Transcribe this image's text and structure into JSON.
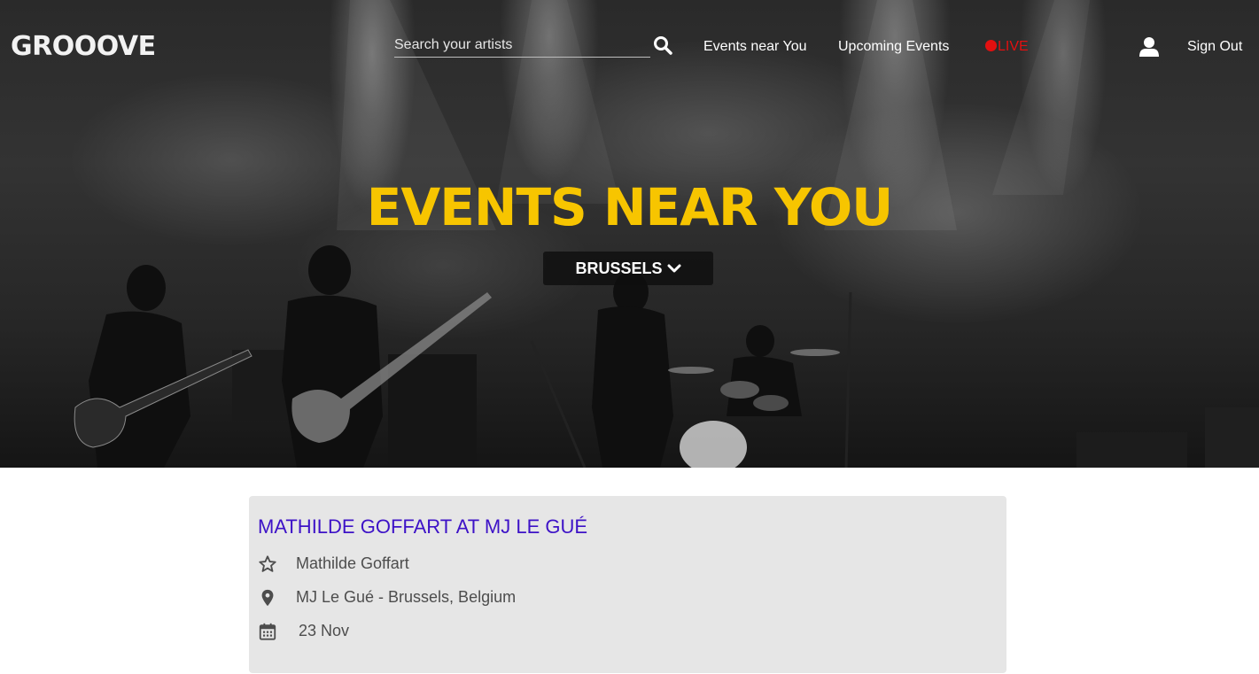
{
  "brand": {
    "logo_text": "GROOOVE"
  },
  "header": {
    "search": {
      "placeholder": "Search your artists",
      "value": ""
    },
    "nav": {
      "events_near_you": "Events near You",
      "upcoming_events": "Upcoming Events",
      "live": "LIVE",
      "sign_out": "Sign Out"
    },
    "icons": {
      "search": "search-icon",
      "user": "user-icon"
    }
  },
  "hero": {
    "title": "EVENTS NEAR YOU",
    "city_selector": {
      "selected": "BRUSSELS",
      "icon": "chevron-down-icon"
    },
    "background": "black-and-white concert photo"
  },
  "events": [
    {
      "title": "MATHILDE GOFFART AT MJ LE GUÉ",
      "artist": "Mathilde Goffart",
      "venue": "MJ Le Gué - Brussels, Belgium",
      "date": "23 Nov",
      "icons": {
        "artist": "star-icon",
        "venue": "location-pin-icon",
        "date": "calendar-icon"
      }
    }
  ],
  "colors": {
    "accent_yellow": "#f7c500",
    "live_red": "#e31010",
    "event_title_purple": "#3d12c7",
    "card_background": "#e6e6e6"
  }
}
